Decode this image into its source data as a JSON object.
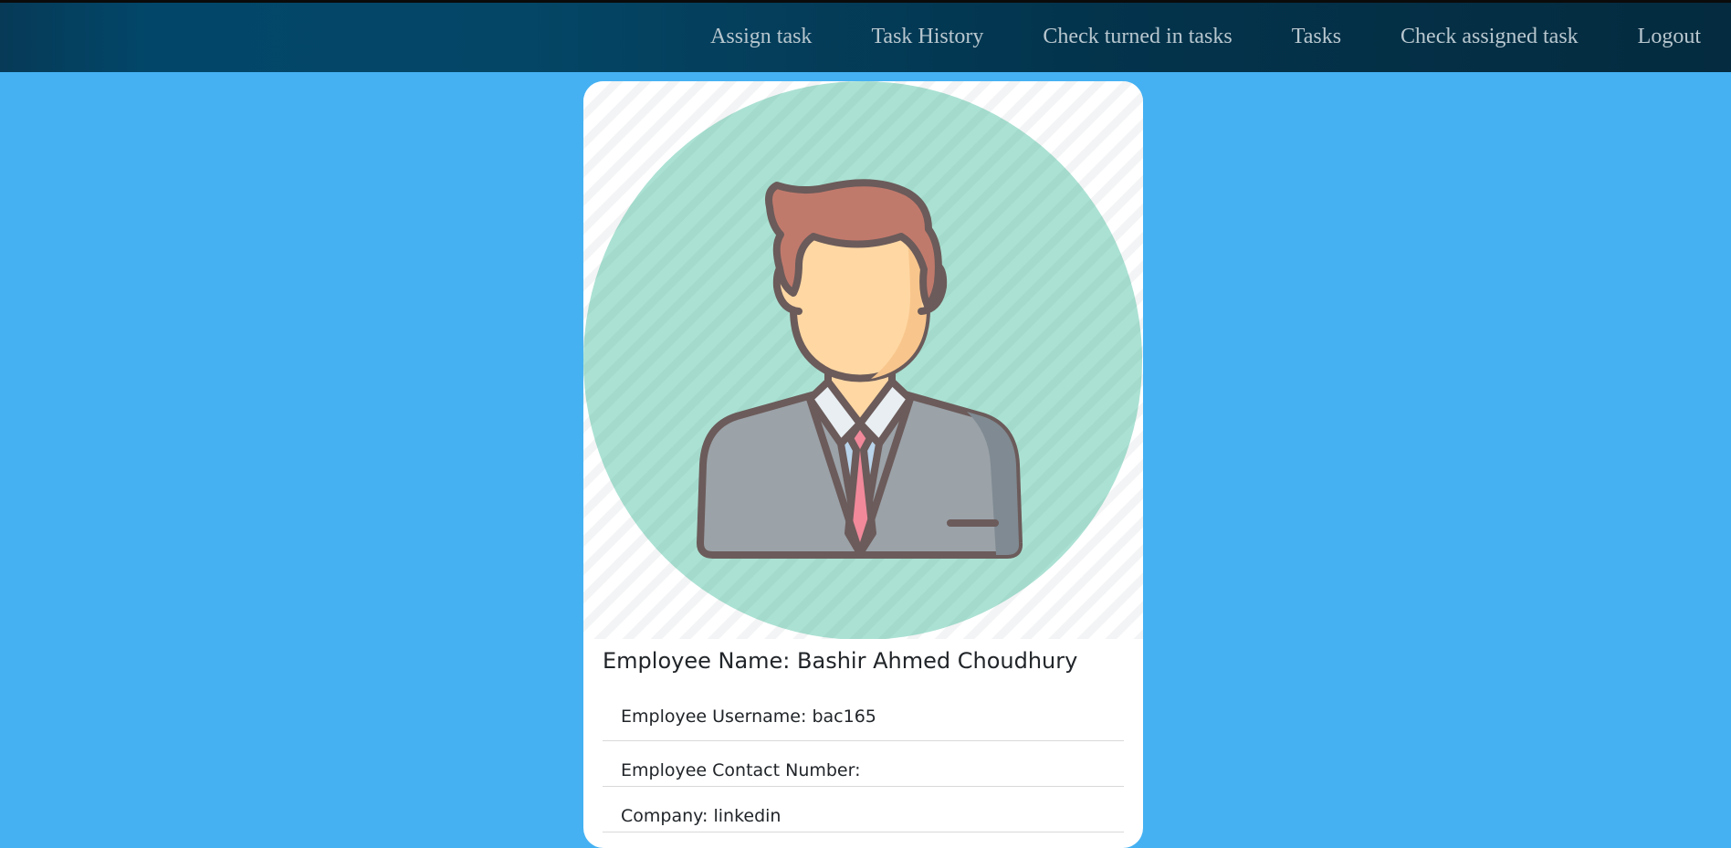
{
  "nav": {
    "items": [
      {
        "label": "Assign task"
      },
      {
        "label": "Task History"
      },
      {
        "label": "Check turned in tasks"
      },
      {
        "label": "Tasks"
      },
      {
        "label": "Check assigned task"
      },
      {
        "label": "Logout"
      }
    ]
  },
  "profile": {
    "image_icon": "businessman-avatar-icon",
    "name_label": "Employee Name:",
    "name_value": "Bashir Ahmed Choudhury",
    "fields": [
      {
        "label": "Employee Username:",
        "value": "bac165"
      },
      {
        "label": "Employee Contact Number:",
        "value": ""
      },
      {
        "label": "Company:",
        "value": "linkedin"
      }
    ]
  },
  "colors": {
    "page_background": "#45b1f2",
    "navbar": "#044666",
    "avatar_circle": "#a8e0d2",
    "tie": "#f1899b",
    "suit": "#9ba2a8",
    "hair": "#c07a6c",
    "skin": "#ffd7a3"
  }
}
